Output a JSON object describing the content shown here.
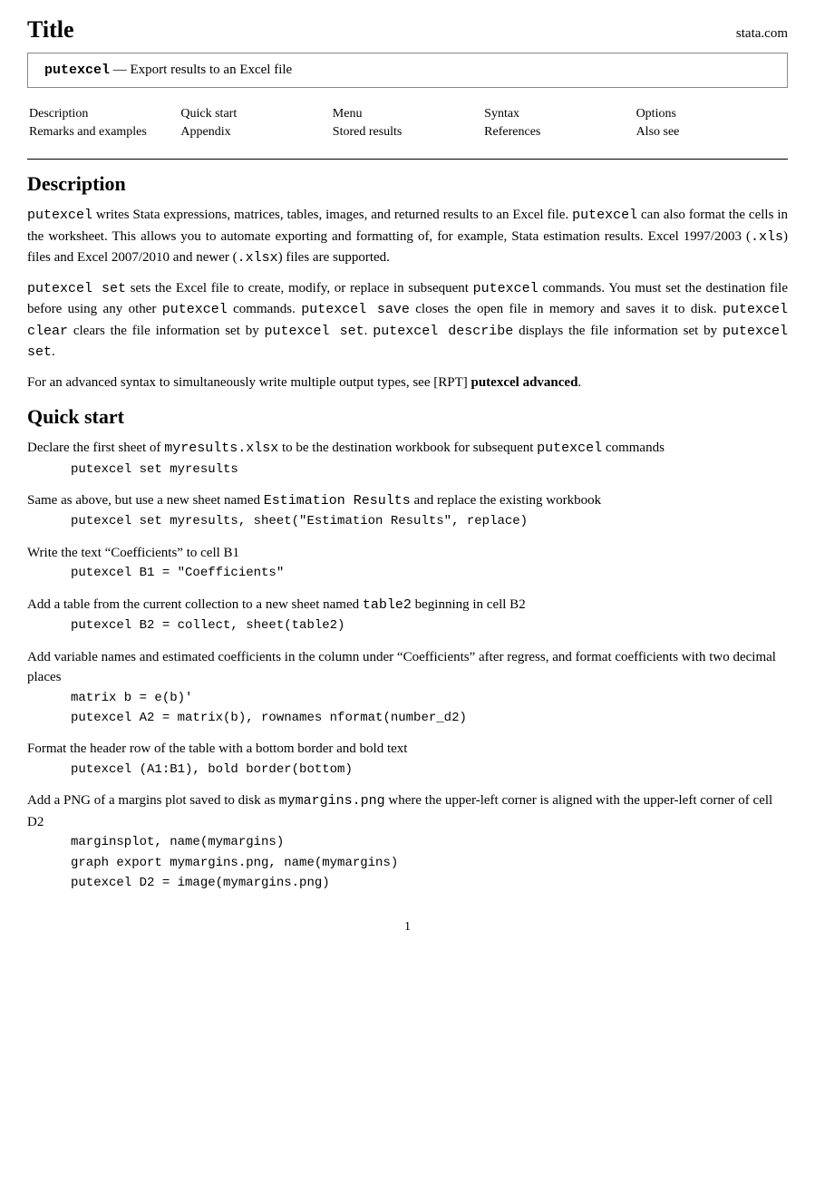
{
  "header": {
    "title": "Title",
    "brand": "stata.com"
  },
  "titlebox": {
    "cmd": "putexcel",
    "dash": "—",
    "desc": "Export results to an Excel file"
  },
  "nav": {
    "col1": [
      "Description",
      "Remarks and examples"
    ],
    "col2": [
      "Quick start",
      "Appendix"
    ],
    "col3": [
      "Menu",
      "Stored results"
    ],
    "col4": [
      "Syntax",
      "References"
    ],
    "col5": [
      "Options",
      "Also see"
    ]
  },
  "description": {
    "heading": "Description",
    "para1": "putexcel writes Stata expressions, matrices, tables, images, and returned results to an Excel file. putexcel can also format the cells in the worksheet. This allows you to automate exporting and formatting of, for example, Stata estimation results. Excel 1997/2003 (.xls) files and Excel 2007/2010 and newer (.xlsx) files are supported.",
    "para2_before": "putexcel set",
    "para2_mid1": " sets the Excel file to create, modify, or replace in subsequent ",
    "para2_mid2": "putexcel",
    "para2_mid3": " commands. You must set the destination file before using any other ",
    "para2_mid4": "putexcel",
    "para2_mid5": " commands. ",
    "para2_mid6": "putexcel save",
    "para2_mid7": " closes the open file in memory and saves it to disk. ",
    "para2_mid8": "putexcel clear",
    "para2_mid9": " clears the file information set by ",
    "para2_mid10": "putexcel set",
    "para2_mid11": ". ",
    "para2_mid12": "putexcel describe",
    "para2_mid13": " displays the file information set by ",
    "para2_mid14": "putexcel set",
    "para2_end": ".",
    "para3": "For an advanced syntax to simultaneously write multiple output types, see [RPT] putexcel advanced."
  },
  "quickstart": {
    "heading": "Quick start",
    "items": [
      {
        "desc": "Declare the first sheet of myresults.xlsx to be the destination workbook for subsequent putexcel commands",
        "code": "putexcel set myresults"
      },
      {
        "desc": "Same as above, but use a new sheet named Estimation Results and replace the existing workbook",
        "code": "putexcel set myresults, sheet(\"Estimation Results\", replace)"
      },
      {
        "desc": "Write the text “Coefficients” to cell B1",
        "code": "putexcel B1 = \"Coefficients\""
      },
      {
        "desc": "Add a table from the current collection to a new sheet named table2 beginning in cell B2",
        "code": "putexcel B2 = collect, sheet(table2)"
      },
      {
        "desc": "Add variable names and estimated coefficients in the column under “Coefficients” after regress, and format coefficients with two decimal places",
        "code_lines": [
          "matrix b = e(b)'",
          "putexcel A2 = matrix(b), rownames nformat(number_d2)"
        ]
      },
      {
        "desc": "Format the header row of the table with a bottom border and bold text",
        "code": "putexcel (A1:B1), bold border(bottom)"
      },
      {
        "desc": "Add a PNG of a margins plot saved to disk as mymargins.png where the upper-left corner is aligned with the upper-left corner of cell D2",
        "code_lines": [
          "marginsplot, name(mymargins)",
          "graph export mymargins.png, name(mymargins)",
          "putexcel D2 = image(mymargins.png)"
        ]
      }
    ]
  },
  "footer": {
    "page_number": "1"
  }
}
